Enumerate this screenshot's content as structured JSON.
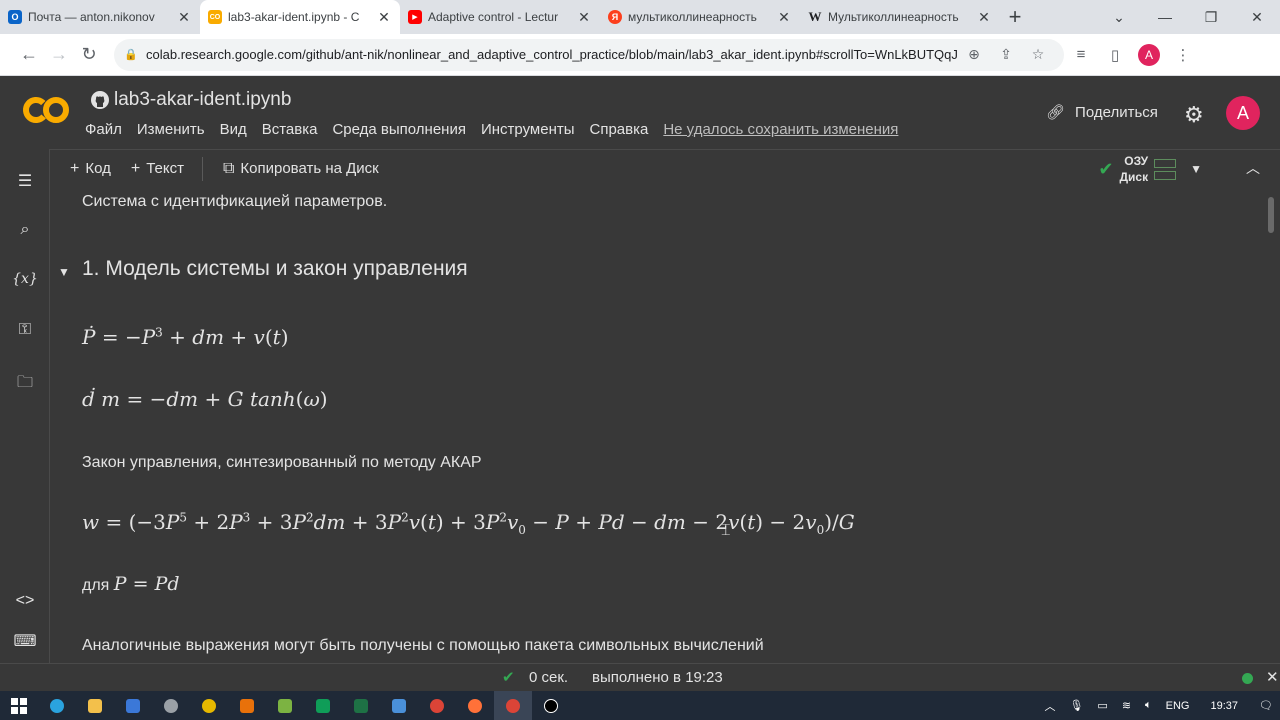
{
  "browser": {
    "tabs": [
      {
        "title": "Почта — anton.nikonov",
        "favicon_color": "#0a64c8",
        "favicon_letter": "O"
      },
      {
        "title": "lab3-akar-ident.ipynb - C",
        "favicon_color": "#f9ab00",
        "favicon_letter": "CO",
        "active": true
      },
      {
        "title": "Adaptive control - Lectur",
        "favicon_color": "#ff0000",
        "favicon_letter": "▶"
      },
      {
        "title": "мультиколлинеарность",
        "favicon_color": "#fc3f1d",
        "favicon_letter": "Я"
      },
      {
        "title": "Мультиколлинеарность",
        "favicon_color": "#ffffff",
        "favicon_letter": "W"
      }
    ],
    "url": "colab.research.google.com/github/ant-nik/nonlinear_and_adaptive_control_practice/blob/main/lab3_akar_ident.ipynb#scrollTo=WnLkBUTQqJ05",
    "profile_letter": "A"
  },
  "colab": {
    "notebook_title": "lab3-akar-ident.ipynb",
    "menu": [
      "Файл",
      "Изменить",
      "Вид",
      "Вставка",
      "Среда выполнения",
      "Инструменты",
      "Справка"
    ],
    "unsaved_notice": "Не удалось сохранить изменения",
    "share_label": "Поделиться",
    "avatar_letter": "A",
    "toolbar": {
      "code_label": "Код",
      "text_label": "Текст",
      "copy_label": "Копировать на Диск",
      "ram_label": "ОЗУ",
      "disk_label": "Диск"
    }
  },
  "notebook": {
    "intro": "Система с идентификацией параметров.",
    "section_title": "1. Модель системы и закон управления",
    "control_law_text": "Закон управления, синтезированный по методу АКАР",
    "condition_prefix": "для",
    "symbolic_text": "Аналогичные выражения могут быть получены с помощью пакета символьных вычислений"
  },
  "status": {
    "elapsed": "0 сек.",
    "completed": "выполнено в 19:23"
  },
  "taskbar": {
    "lang": "ENG",
    "time": "19:37"
  }
}
